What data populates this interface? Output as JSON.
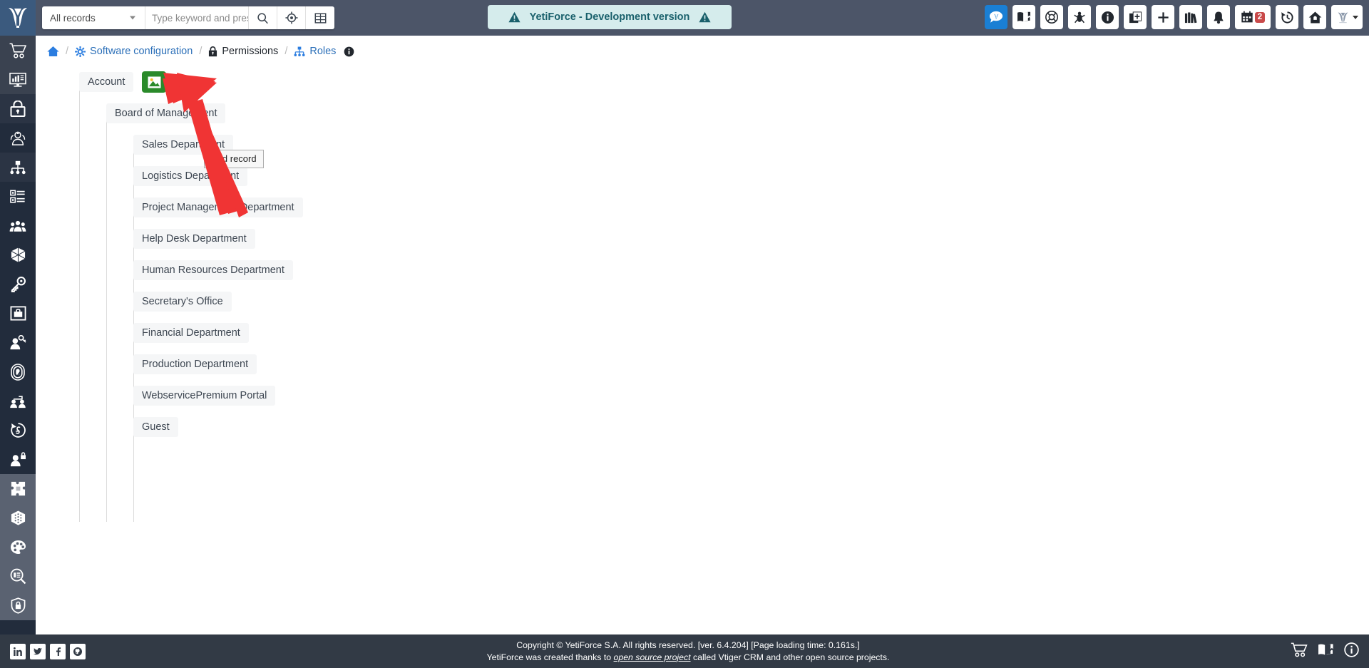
{
  "topbar": {
    "logo_name": "yetiforce-logo",
    "record_filter": {
      "label": "All records",
      "icon": "chevron-down-icon"
    },
    "search": {
      "placeholder": "Type keyword and press e",
      "value": ""
    },
    "buttons": [
      {
        "name": "search-button",
        "icon": "search-icon"
      },
      {
        "name": "advanced-search-button",
        "icon": "crosshair-icon"
      },
      {
        "name": "grid-view-button",
        "icon": "grid-icon"
      }
    ],
    "dev_banner": {
      "text": "YetiForce - Development version",
      "left_icon": "warning-icon",
      "right_icon": "warning-icon",
      "bg": "#d5ecec",
      "fg": "#19606b"
    },
    "right_icons": [
      {
        "name": "chat-button",
        "icon": "chat-icon",
        "active": true
      },
      {
        "name": "documentation-button",
        "icon": "book-icon"
      },
      {
        "name": "support-button",
        "icon": "lifebuoy-icon"
      },
      {
        "name": "bug-report-button",
        "icon": "bug-icon"
      },
      {
        "name": "info-button",
        "icon": "info-circle-icon"
      },
      {
        "name": "quick-create-button",
        "icon": "copy-plus-icon"
      },
      {
        "name": "add-button",
        "icon": "plus-icon"
      },
      {
        "name": "library-button",
        "icon": "books-icon"
      },
      {
        "name": "notifications-button",
        "icon": "bell-icon"
      },
      {
        "name": "calendar-button",
        "icon": "calendar-icon",
        "badge": "2"
      },
      {
        "name": "history-button",
        "icon": "history-icon"
      },
      {
        "name": "home-button",
        "icon": "home-icon"
      },
      {
        "name": "user-menu-button",
        "icon": "yetiforce-avatar-icon",
        "caret": true
      }
    ]
  },
  "sidebar": {
    "items": [
      {
        "name": "sidebar-item-sales",
        "icon": "shopping-cart-icon",
        "state": "lighter"
      },
      {
        "name": "sidebar-item-dashboard",
        "icon": "monitor-chart-icon",
        "state": "lighter"
      },
      {
        "name": "sidebar-item-permissions",
        "icon": "lock-icon",
        "state": "active"
      },
      {
        "name": "sidebar-item-groups",
        "icon": "users-group-icon",
        "state": "normal"
      },
      {
        "name": "sidebar-item-roles",
        "icon": "sitemap-icon",
        "state": "active"
      },
      {
        "name": "sidebar-item-profiles",
        "icon": "list-checks-icon",
        "state": "normal"
      },
      {
        "name": "sidebar-item-sharing",
        "icon": "people-icon",
        "state": "normal"
      },
      {
        "name": "sidebar-item-modules",
        "icon": "cube-icon",
        "state": "normal"
      },
      {
        "name": "sidebar-item-access-key",
        "icon": "key-icon",
        "state": "normal"
      },
      {
        "name": "sidebar-item-privileges",
        "icon": "briefcase-box-icon",
        "state": "normal"
      },
      {
        "name": "sidebar-item-user-key",
        "icon": "user-key-icon",
        "state": "normal"
      },
      {
        "name": "sidebar-item-authentication",
        "icon": "fingerprint-icon",
        "state": "normal"
      },
      {
        "name": "sidebar-item-user-share",
        "icon": "two-users-icon",
        "state": "normal"
      },
      {
        "name": "sidebar-item-refresh-currency",
        "icon": "currency-refresh-icon",
        "state": "normal"
      },
      {
        "name": "sidebar-item-user-lock",
        "icon": "user-lock-icon",
        "state": "normal"
      },
      {
        "name": "sidebar-item-integrations",
        "icon": "puzzle-icon",
        "state": "group2"
      },
      {
        "name": "sidebar-item-data",
        "icon": "cube-dots-icon",
        "state": "group2"
      },
      {
        "name": "sidebar-item-appearance",
        "icon": "palette-icon",
        "state": "group2"
      },
      {
        "name": "sidebar-item-logs",
        "icon": "search-list-icon",
        "state": "group2"
      },
      {
        "name": "sidebar-item-security",
        "icon": "shield-lock-icon",
        "state": "group2"
      }
    ]
  },
  "breadcrumb": {
    "home": {
      "label": "",
      "icon": "home-icon"
    },
    "items": [
      {
        "label": "Software configuration",
        "icon": "gear-icon",
        "style": "link"
      },
      {
        "label": "Permissions",
        "icon": "lock-icon",
        "style": "dark"
      },
      {
        "label": "Roles",
        "icon": "sitemap-icon",
        "style": "link"
      }
    ],
    "info_icon": "info-circle-icon",
    "separator": "/"
  },
  "tree": {
    "root": {
      "label": "Account",
      "level": 1
    },
    "add_record_button": {
      "name": "add-record-button",
      "icon": "image-icon",
      "color": "#2a8a2a"
    },
    "add_plus_button": {
      "name": "add-child-button",
      "icon": "plus-circle-icon",
      "color": "#1a7fd4"
    },
    "tooltip": {
      "text": "Add record"
    },
    "nodes": [
      {
        "label": "Board of Management",
        "level": 2
      },
      {
        "label": "Sales Department",
        "level": 3
      },
      {
        "label": "Logistics Department",
        "level": 3
      },
      {
        "label": "Project Management Department",
        "level": 3
      },
      {
        "label": "Help Desk Department",
        "level": 3
      },
      {
        "label": "Human Resources Department",
        "level": 3
      },
      {
        "label": "Secretary's Office",
        "level": 3
      },
      {
        "label": "Financial Department",
        "level": 3
      },
      {
        "label": "Production Department",
        "level": 3
      },
      {
        "label": "WebservicePremium Portal",
        "level": 3
      },
      {
        "label": "Guest",
        "level": 3
      }
    ]
  },
  "annotation": {
    "arrow_color": "#f03434",
    "arrow_name": "pointer-arrow"
  },
  "footer": {
    "social": [
      {
        "name": "linkedin-icon",
        "glyph": "in"
      },
      {
        "name": "twitter-icon",
        "glyph": "t"
      },
      {
        "name": "facebook-icon",
        "glyph": "f"
      },
      {
        "name": "github-icon",
        "glyph": "g"
      }
    ],
    "copyright_line1": "Copyright © YetiForce S.A. All rights reserved. [ver. 6.4.204] [Page loading time: 0.161s.]",
    "copyright_line2_pre": "YetiForce was created thanks to ",
    "copyright_link": "open source project",
    "copyright_line2_post": " called Vtiger CRM and other open source projects.",
    "right_icons": [
      {
        "name": "shop-cart-icon",
        "icon": "cart-icon"
      },
      {
        "name": "documentation-icon",
        "icon": "book-icon"
      },
      {
        "name": "info-icon",
        "icon": "info-circle-icon"
      }
    ]
  }
}
